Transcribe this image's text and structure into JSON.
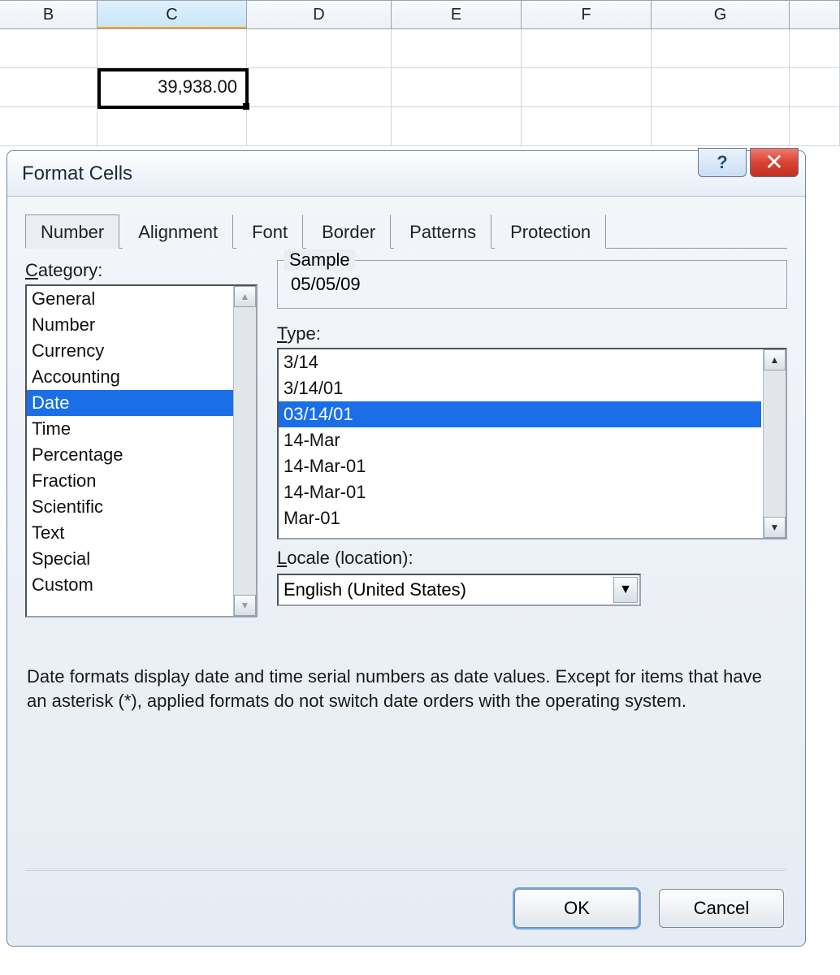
{
  "spreadsheet": {
    "columns": [
      "B",
      "C",
      "D",
      "E",
      "F",
      "G"
    ],
    "selected_column": "C",
    "selected_cell_value": "39,938.00"
  },
  "dialog": {
    "title": "Format Cells",
    "tabs": [
      "Number",
      "Alignment",
      "Font",
      "Border",
      "Patterns",
      "Protection"
    ],
    "active_tab": "Number",
    "category_label": "Category:",
    "categories": [
      "General",
      "Number",
      "Currency",
      "Accounting",
      "Date",
      "Time",
      "Percentage",
      "Fraction",
      "Scientific",
      "Text",
      "Special",
      "Custom"
    ],
    "selected_category": "Date",
    "sample_label": "Sample",
    "sample_value": "05/05/09",
    "type_label": "Type:",
    "types": [
      "3/14",
      "3/14/01",
      "03/14/01",
      "14-Mar",
      "14-Mar-01",
      "14-Mar-01",
      "Mar-01"
    ],
    "selected_type": "03/14/01",
    "locale_label": "Locale (location):",
    "locale_value": "English (United States)",
    "help_text": "Date formats display date and time serial numbers as date values. Except for items that have an asterisk (*), applied formats do not switch date orders with the operating system.",
    "ok_label": "OK",
    "cancel_label": "Cancel"
  }
}
